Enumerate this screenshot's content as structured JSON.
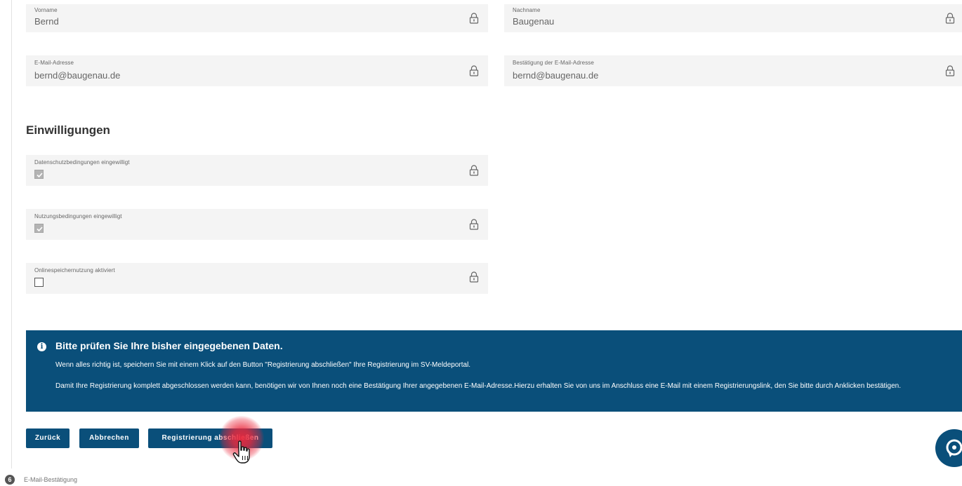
{
  "personal": {
    "first_name": {
      "label": "Vorname",
      "value": "Bernd"
    },
    "last_name": {
      "label": "Nachname",
      "value": "Baugenau"
    },
    "email": {
      "label": "E-Mail-Adresse",
      "value": "bernd@baugenau.de"
    },
    "email_confirm": {
      "label": "Bestätigung der E-Mail-Adresse",
      "value": "bernd@baugenau.de"
    }
  },
  "consents": {
    "title": "Einwilligungen",
    "items": [
      {
        "label": "Datenschutzbedingungen eingewilligt",
        "checked": true
      },
      {
        "label": "Nutzungsbedingungen eingewilligt",
        "checked": true
      },
      {
        "label": "Onlinespeichernutzung aktiviert",
        "checked": false
      }
    ]
  },
  "info": {
    "title": "Bitte prüfen Sie Ihre bisher eingegebenen Daten.",
    "paragraph1": "Wenn alles richtig ist, speichern Sie mit einem Klick auf den Button \"Registrierung abschließen\" Ihre Registrierung im SV-Meldeportal.",
    "paragraph2": "Damit Ihre Registrierung komplett abgeschlossen werden kann, benötigen wir von Ihnen noch eine Bestätigung Ihrer angegebenen E-Mail-Adresse.Hierzu erhalten Sie von uns im Anschluss eine E-Mail mit einem Registrierungslink, den Sie bitte durch Anklicken bestätigen."
  },
  "buttons": {
    "back": "Zurück",
    "cancel": "Abbrechen",
    "submit": "Registrierung abschließen"
  },
  "step": {
    "number": "6",
    "label": "E-Mail-Bestätigung"
  },
  "colors": {
    "primary": "#0a4f7a",
    "field_bg": "#f4f4f4",
    "highlight": "#eb283c"
  },
  "icons": {
    "field_lock": "lock-icon",
    "banner": "info-icon",
    "fab": "help-icon",
    "pointer": "hand-cursor-icon"
  }
}
